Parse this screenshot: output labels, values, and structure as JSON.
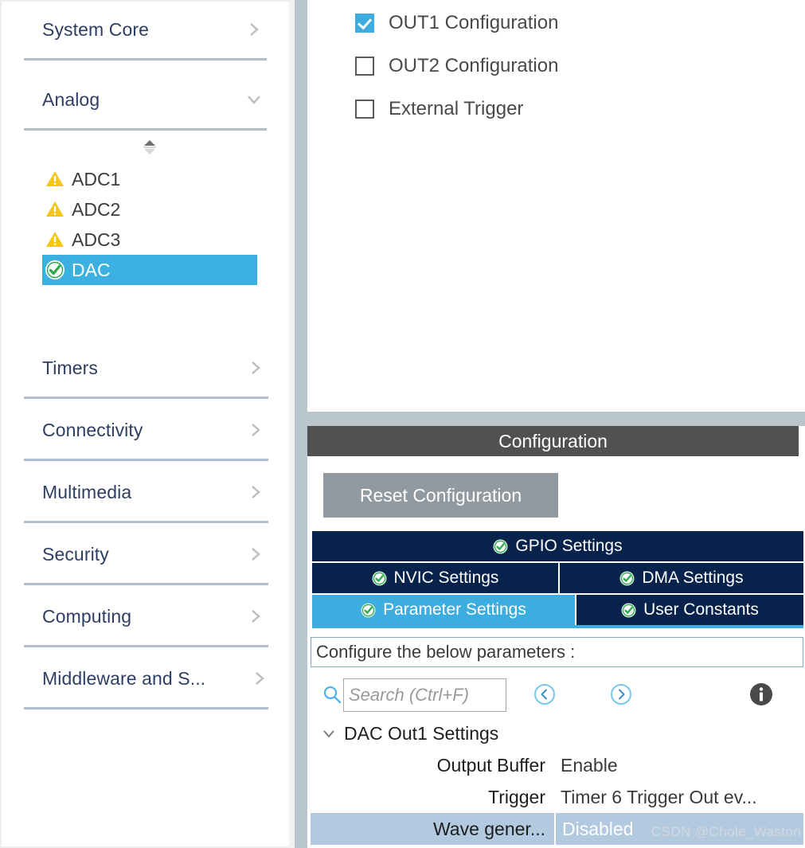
{
  "sidebar": {
    "categories_top": [
      {
        "label": "System Core",
        "chevron": "chevron-right-icon"
      },
      {
        "label": "Analog",
        "chevron": "chevron-down-icon"
      }
    ],
    "peripherals": [
      {
        "label": "ADC1",
        "status": "warning-icon",
        "selected": false
      },
      {
        "label": "ADC2",
        "status": "warning-icon",
        "selected": false
      },
      {
        "label": "ADC3",
        "status": "warning-icon",
        "selected": false
      },
      {
        "label": "DAC",
        "status": "check-circle-icon",
        "selected": true
      }
    ],
    "categories_bottom": [
      {
        "label": "Timers",
        "chevron": "chevron-right-icon"
      },
      {
        "label": "Connectivity",
        "chevron": "chevron-right-icon"
      },
      {
        "label": "Multimedia",
        "chevron": "chevron-right-icon"
      },
      {
        "label": "Security",
        "chevron": "chevron-right-icon"
      },
      {
        "label": "Computing",
        "chevron": "chevron-right-icon"
      },
      {
        "label": "Middleware and S...",
        "chevron": "chevron-right-icon"
      }
    ],
    "splitter": "splitter-handle-icon"
  },
  "mode_panel": {
    "checkboxes": [
      {
        "label": "OUT1 Configuration",
        "checked": true
      },
      {
        "label": "OUT2 Configuration",
        "checked": false
      },
      {
        "label": "External Trigger",
        "checked": false
      }
    ]
  },
  "configuration": {
    "header_title": "Configuration",
    "reset_button": "Reset Configuration",
    "tabs": [
      {
        "label": "GPIO Settings",
        "active": false,
        "icon": "check-circle-icon",
        "row": 1
      },
      {
        "label": "NVIC Settings",
        "active": false,
        "icon": "check-circle-icon",
        "row": 2
      },
      {
        "label": "DMA Settings",
        "active": false,
        "icon": "check-circle-icon",
        "row": 2
      },
      {
        "label": "Parameter Settings",
        "active": true,
        "icon": "check-circle-icon",
        "row": 3
      },
      {
        "label": "User Constants",
        "active": false,
        "icon": "check-circle-icon",
        "row": 3
      }
    ],
    "configure_hint": "Configure the below parameters :",
    "search": {
      "placeholder": "Search (Ctrl+F)",
      "value": "",
      "icon": "search-icon",
      "prev_icon": "nav-previous-icon",
      "next_icon": "nav-next-icon",
      "info_icon": "info-icon"
    },
    "parameter_tree": {
      "group_label": "DAC Out1 Settings",
      "group_expanded": true,
      "rows": [
        {
          "name": "Output Buffer",
          "value": "Enable",
          "selected": false
        },
        {
          "name": "Trigger",
          "value": "Timer 6 Trigger Out ev...",
          "selected": false
        },
        {
          "name": "Wave gener...",
          "value": "Disabled",
          "selected": true
        }
      ]
    }
  },
  "watermark": "CSDN @Chole_Waston",
  "colors": {
    "accent_blue": "#3cadde",
    "tab_navy": "#07234c",
    "header_gray": "#4f5152",
    "button_gray": "#919aa1",
    "strip_blue_gray": "#bac6ce",
    "row_selected": "#b3c9e0",
    "warning_yellow": "#f5c518",
    "ok_green": "#2aa84a",
    "category_text": "#2e3e62"
  }
}
